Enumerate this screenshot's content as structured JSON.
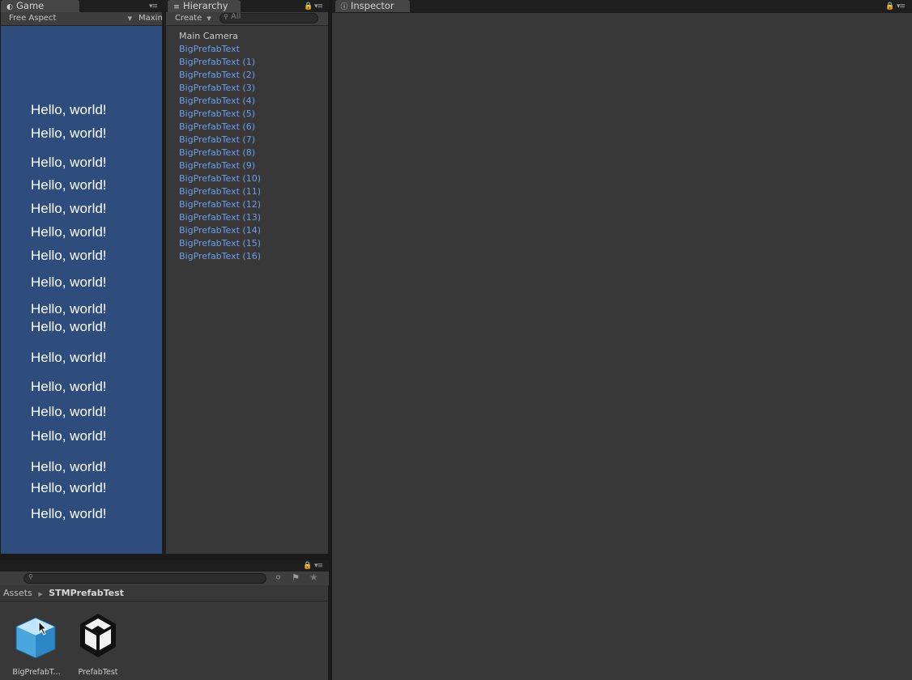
{
  "game": {
    "tab_label": "Game",
    "aspect": "Free Aspect",
    "maximize_label": "Maxim",
    "lines": [
      "Hello, world!",
      "Hello, world!",
      "Hello, world!",
      "Hello, world!",
      "Hello, world!",
      "Hello, world!",
      "Hello, world!",
      "Hello, world!",
      "Hello, world!",
      "Hello, world!",
      "Hello, world!",
      "Hello, world!",
      "Hello, world!",
      "Hello, world!",
      "Hello, world!",
      "Hello, world!",
      "Hello, world!"
    ],
    "background_color": "#2f4d7c"
  },
  "hierarchy": {
    "tab_label": "Hierarchy",
    "create_label": "Create",
    "search_placeholder": "All",
    "items": [
      "Main Camera",
      "BigPrefabText",
      "BigPrefabText (1)",
      "BigPrefabText (2)",
      "BigPrefabText (3)",
      "BigPrefabText (4)",
      "BigPrefabText (5)",
      "BigPrefabText (6)",
      "BigPrefabText (7)",
      "BigPrefabText (8)",
      "BigPrefabText (9)",
      "BigPrefabText (10)",
      "BigPrefabText (11)",
      "BigPrefabText (12)",
      "BigPrefabText (13)",
      "BigPrefabText (14)",
      "BigPrefabText (15)",
      "BigPrefabText (16)"
    ],
    "prefab_color": "#6e9ee8"
  },
  "inspector": {
    "tab_label": "Inspector"
  },
  "project": {
    "breadcrumb_root": "Assets",
    "breadcrumb_folder": "STMPrefabTest",
    "assets": [
      {
        "label": "BigPrefabT...",
        "icon": "prefab-cube-icon"
      },
      {
        "label": "PrefabTest",
        "icon": "unity-scene-icon"
      }
    ]
  }
}
